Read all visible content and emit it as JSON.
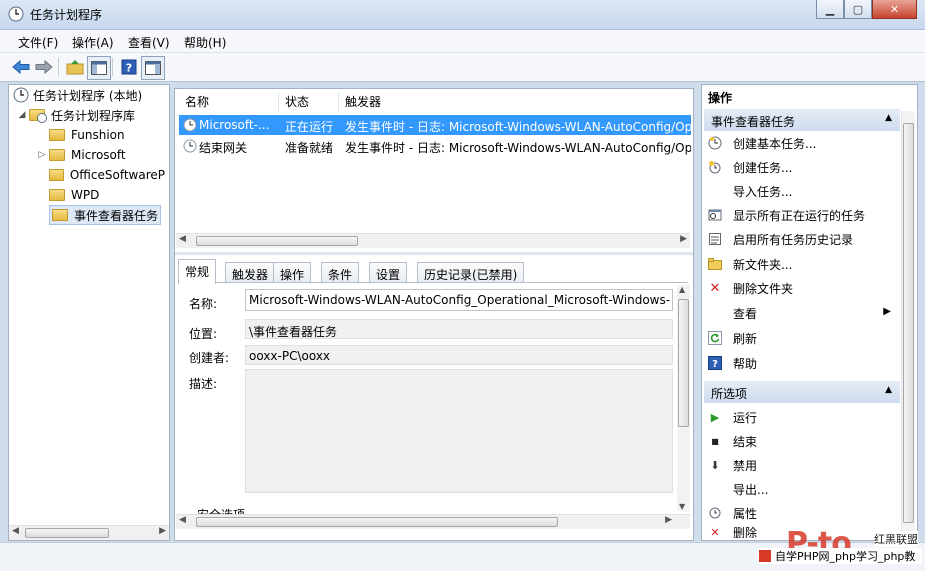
{
  "window": {
    "title": "任务计划程序"
  },
  "menu": [
    "文件(F)",
    "操作(A)",
    "查看(V)",
    "帮助(H)"
  ],
  "tree": {
    "root": "任务计划程序 (本地)",
    "library": "任务计划程序库",
    "children": [
      "Funshion",
      "Microsoft",
      "OfficeSoftwareP",
      "WPD",
      "事件查看器任务"
    ]
  },
  "list": {
    "columns": [
      "名称",
      "状态",
      "触发器"
    ],
    "rows": [
      {
        "name": "Microsoft-...",
        "status": "正在运行",
        "trigger": "发生事件时 - 日志: Microsoft-Windows-WLAN-AutoConfig/Op"
      },
      {
        "name": "结束网关",
        "status": "准备就绪",
        "trigger": "发生事件时 - 日志: Microsoft-Windows-WLAN-AutoConfig/Op"
      }
    ]
  },
  "tabs": [
    "常规",
    "触发器",
    "操作",
    "条件",
    "设置",
    "历史记录(已禁用)"
  ],
  "general": {
    "name_label": "名称:",
    "name_value": "Microsoft-Windows-WLAN-AutoConfig_Operational_Microsoft-Windows-",
    "location_label": "位置:",
    "location_value": "\\事件查看器任务",
    "author_label": "创建者:",
    "author_value": "ooxx-PC\\ooxx",
    "desc_label": "描述:",
    "security_label": "安全选项"
  },
  "actions": {
    "header": "操作",
    "section1": "事件查看器任务",
    "items1": [
      {
        "label": "创建基本任务...",
        "icon": "create-basic-task-icon"
      },
      {
        "label": "创建任务...",
        "icon": "create-task-icon"
      },
      {
        "label": "导入任务...",
        "icon": ""
      },
      {
        "label": "显示所有正在运行的任务",
        "icon": "running-tasks-icon"
      },
      {
        "label": "启用所有任务历史记录",
        "icon": "history-icon"
      },
      {
        "label": "新文件夹...",
        "icon": "new-folder-icon"
      },
      {
        "label": "删除文件夹",
        "icon": "delete-icon"
      },
      {
        "label": "查看",
        "icon": ""
      },
      {
        "label": "刷新",
        "icon": "refresh-icon"
      },
      {
        "label": "帮助",
        "icon": "help-icon"
      }
    ],
    "section2": "所选项",
    "items2": [
      {
        "label": "运行",
        "icon": "run-icon"
      },
      {
        "label": "结束",
        "icon": "stop-icon"
      },
      {
        "label": "禁用",
        "icon": "disable-icon"
      },
      {
        "label": "导出...",
        "icon": ""
      },
      {
        "label": "属性",
        "icon": "properties-icon"
      },
      {
        "label": "删除",
        "icon": "delete-icon"
      }
    ]
  },
  "watermark": {
    "logo": "P-to",
    "side": "红黑联盟",
    "banner": "自学PHP网_php学习_php教"
  },
  "colors": {
    "selection": "#3399ff",
    "section_bg": "#cfdcee"
  }
}
